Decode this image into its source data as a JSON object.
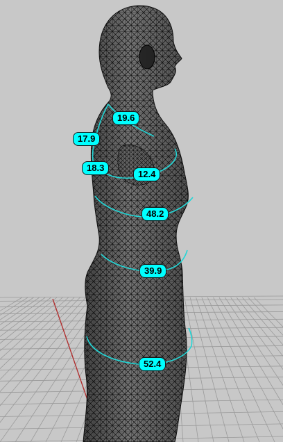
{
  "viewport": {
    "background_color": "#c8c8c8",
    "grid_color": "#9a9a9a",
    "axis_color": "#b03030",
    "mesh_color": "#141414",
    "curve_color": "#22d6d6",
    "label_color": "#00ffff"
  },
  "measurements": [
    {
      "id": "neck",
      "value": "19.6"
    },
    {
      "id": "shoulder",
      "value": "17.9"
    },
    {
      "id": "upper-arm",
      "value": "18.3"
    },
    {
      "id": "arm-front",
      "value": "12.4"
    },
    {
      "id": "chest",
      "value": "48.2"
    },
    {
      "id": "waist",
      "value": "39.9"
    },
    {
      "id": "hips",
      "value": "52.4"
    }
  ]
}
